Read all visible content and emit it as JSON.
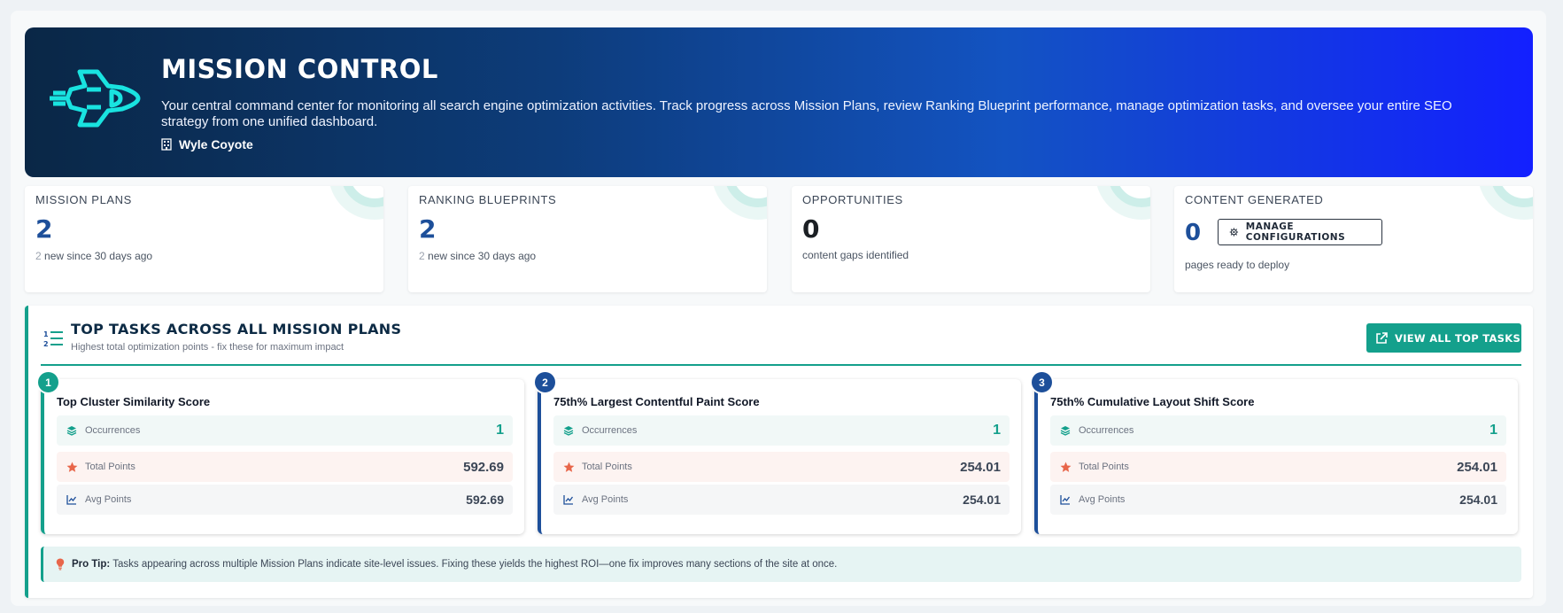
{
  "hero": {
    "title": "MISSION CONTROL",
    "description": "Your central command center for monitoring all search engine optimization activities. Track progress across Mission Plans, review Ranking Blueprint performance, manage optimization tasks, and oversee your entire SEO strategy from one unified dashboard.",
    "user": "Wyle Coyote",
    "icon": "spaceship-icon"
  },
  "stats": [
    {
      "label": "MISSION PLANS",
      "value": "2",
      "sub_count": "2",
      "sub_text": " new since 30 days ago"
    },
    {
      "label": "RANKING BLUEPRINTS",
      "value": "2",
      "sub_count": "2",
      "sub_text": " new since 30 days ago"
    },
    {
      "label": "OPPORTUNITIES",
      "value": "0",
      "sub_text": "content gaps identified"
    },
    {
      "label": "CONTENT GENERATED",
      "value": "0",
      "button": "MANAGE CONFIGURATIONS",
      "sub_text": "pages ready to deploy"
    }
  ],
  "tasks_panel": {
    "title": "TOP TASKS ACROSS ALL MISSION PLANS",
    "subtitle": "Highest total optimization points - fix these for maximum impact",
    "view_all": "VIEW ALL TOP TASKS",
    "metric_labels": {
      "occurrences": "Occurrences",
      "total": "Total Points",
      "avg": "Avg Points"
    },
    "tasks": [
      {
        "rank": "1",
        "title": "Top Cluster Similarity Score",
        "occurrences": "1",
        "total": "592.69",
        "avg": "592.69"
      },
      {
        "rank": "2",
        "title": "75th% Largest Contentful Paint Score",
        "occurrences": "1",
        "total": "254.01",
        "avg": "254.01"
      },
      {
        "rank": "3",
        "title": "75th% Cumulative Layout Shift Score",
        "occurrences": "1",
        "total": "254.01",
        "avg": "254.01"
      }
    ],
    "tip_label": "Pro Tip:",
    "tip_text": " Tasks appearing across multiple Mission Plans indicate site-level issues. Fixing these yields the highest ROI—one fix improves many sections of the site at once."
  },
  "colors": {
    "teal": "#14a08c",
    "navy": "#1d4f9a",
    "hero_start": "#0a2746",
    "hero_end": "#1320ff",
    "star": "#e8664a"
  }
}
